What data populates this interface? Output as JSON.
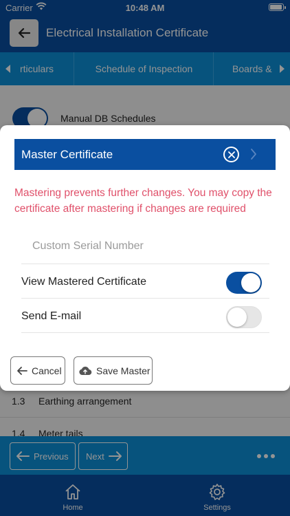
{
  "status_bar": {
    "carrier": "Carrier",
    "time": "10:48 AM"
  },
  "header": {
    "title": "Electrical Installation Certificate",
    "back_icon": "arrow-left-icon"
  },
  "tabs": [
    {
      "label": "rticulars"
    },
    {
      "label": "Schedule of Inspection"
    },
    {
      "label": "Boards &"
    }
  ],
  "background": {
    "manual_db_label": "Manual DB Schedules",
    "rows": [
      {
        "num": "1.3",
        "text": "Earthing arrangement"
      },
      {
        "num": "1.4",
        "text": "Meter tails"
      }
    ]
  },
  "nav_bar": {
    "previous_label": "Previous",
    "next_label": "Next"
  },
  "tab_bar": {
    "home_label": "Home",
    "settings_label": "Settings"
  },
  "dialog": {
    "title": "Master Certificate",
    "warning": "Mastering prevents further changes. You may copy the certificate after mastering if changes are required",
    "serial_placeholder": "Custom Serial Number",
    "serial_value": "",
    "view_mastered_label": "View Mastered Certificate",
    "view_mastered_on": true,
    "send_email_label": "Send E-mail",
    "send_email_on": false,
    "cancel_label": "Cancel",
    "save_label": "Save Master"
  },
  "colors": {
    "primary": "#0a4fa0",
    "accent": "#0d8fd8",
    "warning_text": "#e0506a"
  }
}
